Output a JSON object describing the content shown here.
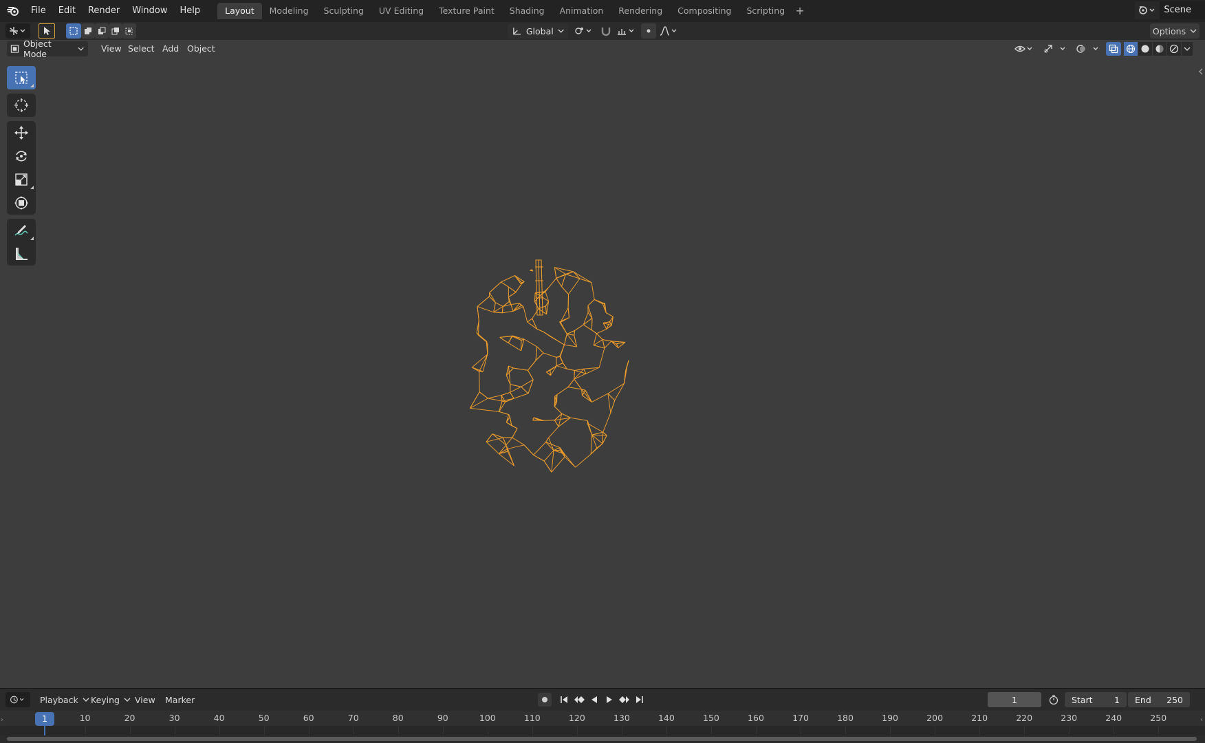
{
  "app": {
    "menus": [
      "File",
      "Edit",
      "Render",
      "Window",
      "Help"
    ],
    "workspaces": [
      "Layout",
      "Modeling",
      "Sculpting",
      "UV Editing",
      "Texture Paint",
      "Shading",
      "Animation",
      "Rendering",
      "Compositing",
      "Scripting"
    ],
    "active_workspace": "Layout",
    "add_workspace": "+",
    "scene": "Scene"
  },
  "tool_header": {
    "orientation": "Global",
    "options": "Options"
  },
  "viewport": {
    "mode": "Object Mode",
    "menus": [
      "View",
      "Select",
      "Add",
      "Object"
    ],
    "shading_active": "solid-shading-icon",
    "object_color": "#e89a2c",
    "background": "#3d3d3d"
  },
  "toolbar": {
    "tools": [
      "select-box-icon",
      "cursor-icon",
      "move-icon",
      "rotate-icon",
      "scale-icon",
      "transform-icon",
      "annotate-icon",
      "measure-icon"
    ],
    "active_tool": "select-box-icon"
  },
  "timeline": {
    "menus": {
      "playback": "Playback",
      "keying": "Keying",
      "view": "View",
      "marker": "Marker"
    },
    "current_frame": "1",
    "start_label": "Start",
    "start_value": "1",
    "end_label": "End",
    "end_value": "250",
    "ticks": [
      "10",
      "20",
      "30",
      "40",
      "50",
      "60",
      "70",
      "80",
      "90",
      "100",
      "110",
      "120",
      "130",
      "140",
      "150",
      "160",
      "170",
      "180",
      "190",
      "200",
      "210",
      "220",
      "230",
      "240",
      "250"
    ],
    "accent": "#4772b3"
  }
}
